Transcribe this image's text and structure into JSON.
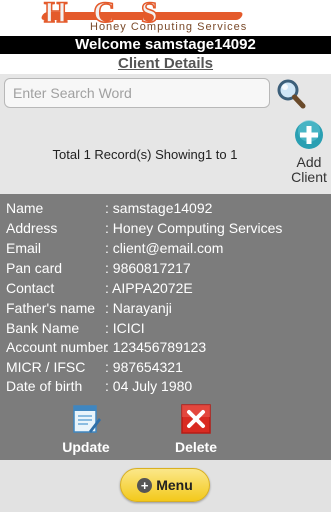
{
  "logo": {
    "letters": "HCS",
    "tagline": "Honey Computing Services"
  },
  "header": {
    "welcome": "Welcome samstage14092",
    "section_title": "Client Details"
  },
  "search": {
    "placeholder": "Enter Search Word",
    "value": ""
  },
  "summary": {
    "total_text": "Total 1 Record(s) Showing1 to 1"
  },
  "add_client": {
    "label_line1": "Add",
    "label_line2": "Client"
  },
  "client": {
    "fields": [
      {
        "key": "Name",
        "value": ": samstage14092"
      },
      {
        "key": "Address",
        "value": ": Honey Computing Services"
      },
      {
        "key": "Email",
        "value": ": client@email.com"
      },
      {
        "key": "Pan card",
        "value": ": 9860817217"
      },
      {
        "key": "Contact",
        "value": ": AIPPA2072E"
      },
      {
        "key": "Father's name",
        "value": ": Narayanji"
      },
      {
        "key": "Bank Name",
        "value": ": ICICI"
      },
      {
        "key": "Account number",
        "value": ": 123456789123"
      },
      {
        "key": "MICR / IFSC",
        "value": ": 987654321"
      },
      {
        "key": "Date of birth",
        "value": ": 04 July 1980"
      }
    ]
  },
  "actions": {
    "update_label": "Update",
    "delete_label": "Delete"
  },
  "footer": {
    "menu_label": "Menu"
  },
  "colors": {
    "detail_bg": "#7c7c7c",
    "accent_orange": "#e45a2b",
    "menu_yellow": "#f3c91b",
    "delete_red": "#d92b22",
    "add_teal": "#2a9fb2"
  }
}
